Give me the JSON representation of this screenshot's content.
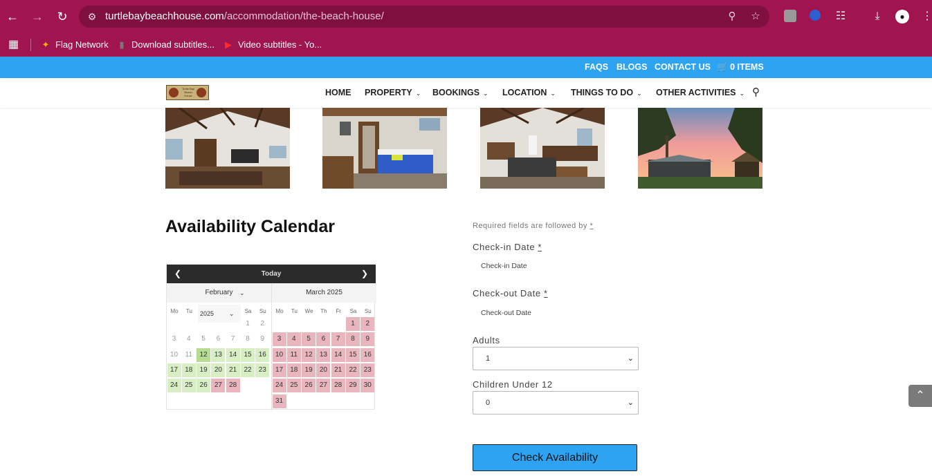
{
  "browser": {
    "url_domain": "turtlebaybeachhouse.com",
    "url_path": "/accommodation/the-beach-house/",
    "bookmarks": [
      {
        "label": "Flag Network"
      },
      {
        "label": "Download subtitles..."
      },
      {
        "label": "Video subtitles - Yo..."
      }
    ]
  },
  "topbar": {
    "links": [
      "FAQS",
      "BLOGS",
      "CONTACT US"
    ],
    "cart_label": "0 ITEMS"
  },
  "logo": {
    "text": "Turtle Bay Beach House"
  },
  "nav": {
    "home": "HOME",
    "property": "PROPERTY",
    "bookings": "BOOKINGS",
    "location": "LOCATION",
    "things": "THINGS TO DO",
    "other": "OTHER ACTIVITIES"
  },
  "calendar": {
    "title": "Availability Calendar",
    "today_label": "Today",
    "month1_label": "February",
    "year_label": "2025",
    "month2_label": "March 2025",
    "weekdays": [
      "Mo",
      "Tu",
      "We",
      "Th",
      "Fr",
      "Sa",
      "Su"
    ],
    "month1_days": [
      {
        "d": "1",
        "s": "past"
      },
      {
        "d": "2",
        "s": "past"
      },
      {
        "d": "3",
        "s": "past"
      },
      {
        "d": "4",
        "s": "past"
      },
      {
        "d": "5",
        "s": "past"
      },
      {
        "d": "6",
        "s": "past"
      },
      {
        "d": "7",
        "s": "past"
      },
      {
        "d": "8",
        "s": "past"
      },
      {
        "d": "9",
        "s": "past"
      },
      {
        "d": "10",
        "s": "past"
      },
      {
        "d": "11",
        "s": "past"
      },
      {
        "d": "12",
        "s": "today"
      },
      {
        "d": "13",
        "s": "avail"
      },
      {
        "d": "14",
        "s": "avail"
      },
      {
        "d": "15",
        "s": "avail"
      },
      {
        "d": "16",
        "s": "avail"
      },
      {
        "d": "17",
        "s": "avail"
      },
      {
        "d": "18",
        "s": "avail"
      },
      {
        "d": "19",
        "s": "avail"
      },
      {
        "d": "20",
        "s": "avail"
      },
      {
        "d": "21",
        "s": "avail"
      },
      {
        "d": "22",
        "s": "avail"
      },
      {
        "d": "23",
        "s": "avail"
      },
      {
        "d": "24",
        "s": "avail"
      },
      {
        "d": "25",
        "s": "avail"
      },
      {
        "d": "26",
        "s": "avail"
      },
      {
        "d": "27",
        "s": "booked"
      },
      {
        "d": "28",
        "s": "booked"
      }
    ],
    "month2_days": [
      {
        "d": "1",
        "s": "booked"
      },
      {
        "d": "2",
        "s": "booked"
      },
      {
        "d": "3",
        "s": "booked"
      },
      {
        "d": "4",
        "s": "booked"
      },
      {
        "d": "5",
        "s": "booked"
      },
      {
        "d": "6",
        "s": "booked"
      },
      {
        "d": "7",
        "s": "booked"
      },
      {
        "d": "8",
        "s": "booked"
      },
      {
        "d": "9",
        "s": "booked"
      },
      {
        "d": "10",
        "s": "booked"
      },
      {
        "d": "11",
        "s": "booked"
      },
      {
        "d": "12",
        "s": "booked"
      },
      {
        "d": "13",
        "s": "booked"
      },
      {
        "d": "14",
        "s": "booked"
      },
      {
        "d": "15",
        "s": "booked"
      },
      {
        "d": "16",
        "s": "booked"
      },
      {
        "d": "17",
        "s": "booked"
      },
      {
        "d": "18",
        "s": "booked"
      },
      {
        "d": "19",
        "s": "booked"
      },
      {
        "d": "20",
        "s": "booked"
      },
      {
        "d": "21",
        "s": "booked"
      },
      {
        "d": "22",
        "s": "booked"
      },
      {
        "d": "23",
        "s": "booked"
      },
      {
        "d": "24",
        "s": "booked"
      },
      {
        "d": "25",
        "s": "booked"
      },
      {
        "d": "26",
        "s": "booked"
      },
      {
        "d": "27",
        "s": "booked"
      },
      {
        "d": "28",
        "s": "booked"
      },
      {
        "d": "29",
        "s": "booked"
      },
      {
        "d": "30",
        "s": "booked"
      },
      {
        "d": "31",
        "s": "booked"
      }
    ]
  },
  "form": {
    "required_note": "Required fields are followed by",
    "required_mark": "*",
    "checkin_label": "Check-in Date",
    "checkin_placeholder": "Check-in Date",
    "checkout_label": "Check-out Date",
    "checkout_placeholder": "Check-out Date",
    "adults_label": "Adults",
    "adults_value": "1",
    "children_label": "Children Under 12",
    "children_value": "0",
    "submit_label": "Check Availability"
  },
  "colors": {
    "browser_bar": "#a0144f",
    "topbar": "#2ea3f2",
    "available": "#d8eec4",
    "booked": "#e8b6bc",
    "button": "#2ea3f2"
  },
  "icons": [
    "back-icon",
    "forward-icon",
    "reload-icon",
    "site-info-icon",
    "zoom-icon",
    "star-icon",
    "extensions-icon",
    "download-icon",
    "profile-icon",
    "menu-dots-icon",
    "apps-grid-icon",
    "cart-icon",
    "search-icon",
    "chevron-down-icon",
    "scroll-top-icon"
  ]
}
